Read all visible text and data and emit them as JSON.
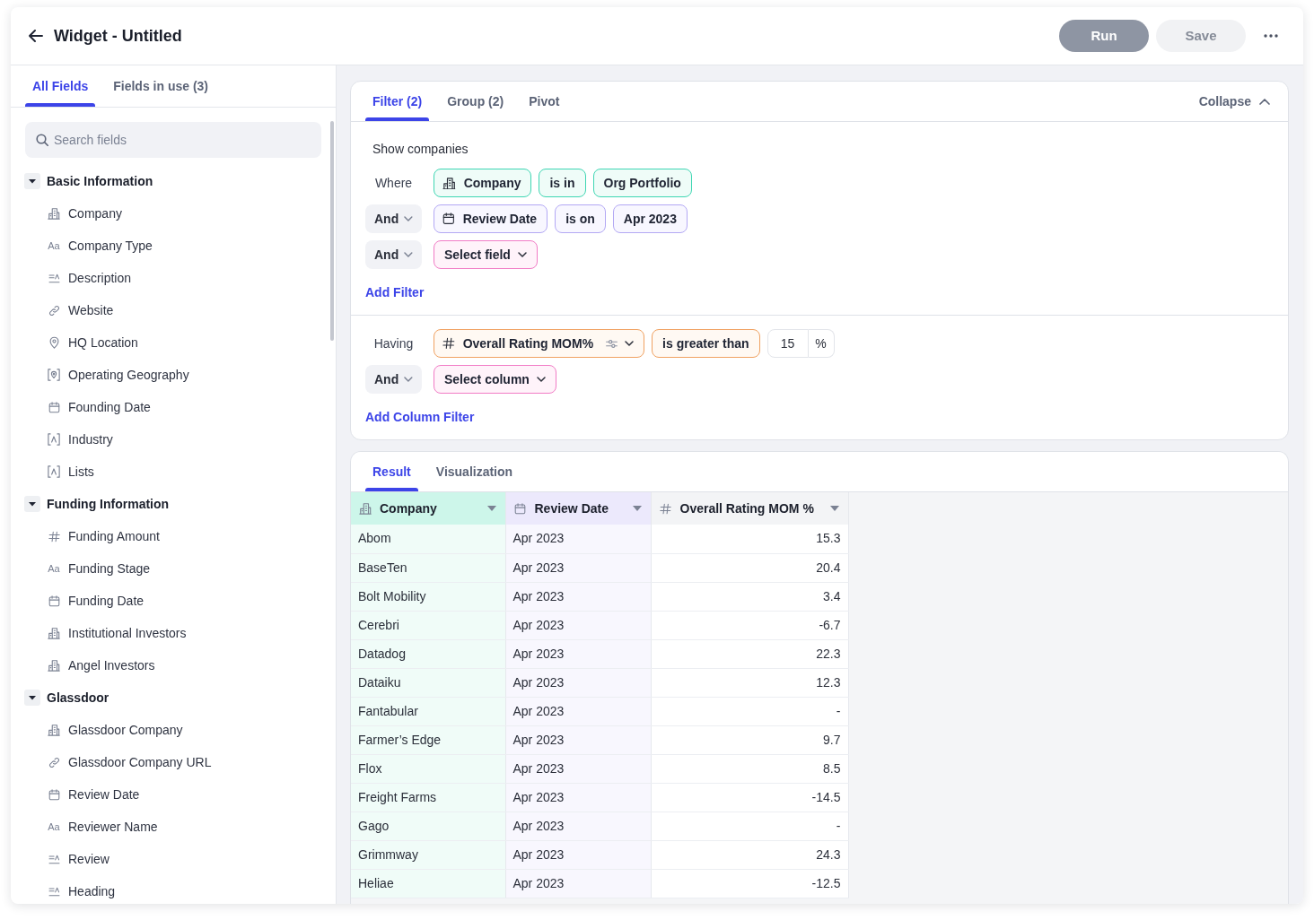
{
  "header": {
    "title": "Widget - Untitled",
    "buttons": [
      {
        "label": "Run",
        "kind": "primary",
        "disabled": true
      },
      {
        "label": "Save",
        "kind": "secondary",
        "disabled": true
      }
    ]
  },
  "sidebar": {
    "tabs": [
      {
        "label": "All Fields",
        "selected": true
      },
      {
        "label": "Fields in use (3)",
        "selected": false
      }
    ],
    "search": {
      "placeholder": "Search fields"
    },
    "groups": [
      {
        "label": "Basic Information",
        "expanded": true,
        "children": [
          {
            "label": "Company",
            "kind": "entity"
          },
          {
            "label": "Company Type",
            "kind": "text",
            "glyph": "Aa"
          },
          {
            "label": "Description",
            "kind": "longtext"
          },
          {
            "label": "Website",
            "kind": "link"
          },
          {
            "label": "HQ Location",
            "kind": "location"
          },
          {
            "label": "Operating Geography",
            "kind": "region"
          },
          {
            "label": "Founding Date",
            "kind": "date"
          },
          {
            "label": "Industry",
            "kind": "tag"
          },
          {
            "label": "Lists",
            "kind": "tag"
          }
        ]
      },
      {
        "label": "Funding Information",
        "expanded": true,
        "children": [
          {
            "label": "Funding Amount",
            "kind": "number"
          },
          {
            "label": "Funding Stage",
            "kind": "text",
            "glyph": "Aa"
          },
          {
            "label": "Funding Date",
            "kind": "date"
          },
          {
            "label": "Institutional Investors",
            "kind": "entity"
          },
          {
            "label": "Angel Investors",
            "kind": "entity"
          }
        ]
      },
      {
        "label": "Glassdoor",
        "expanded": true,
        "children": [
          {
            "label": "Glassdoor Company",
            "kind": "entity"
          },
          {
            "label": "Glassdoor Company URL",
            "kind": "link"
          },
          {
            "label": "Review Date",
            "kind": "date"
          },
          {
            "label": "Reviewer Name",
            "kind": "text",
            "glyph": "Aa"
          },
          {
            "label": "Review",
            "kind": "longtext"
          },
          {
            "label": "Heading",
            "kind": "longtext"
          }
        ]
      }
    ]
  },
  "query": {
    "tabs": [
      {
        "label": "Filter (2)",
        "selected": true
      },
      {
        "label": "Group (2)",
        "selected": false
      },
      {
        "label": "Pivot",
        "selected": false
      }
    ],
    "collapse": "Collapse",
    "sections": [
      {
        "intro": "Show companies",
        "rows": [
          {
            "kind": "condition",
            "connector": {
              "label": "Where",
              "dropdown": false
            },
            "field": {
              "label": "Company",
              "kind": "entity",
              "dropdown": false
            },
            "operator": "is in",
            "value": {
              "kind": "chip",
              "text": "Org Portfolio"
            }
          },
          {
            "kind": "condition",
            "connector": {
              "label": "And",
              "dropdown": true
            },
            "field": {
              "label": "Review Date",
              "kind": "date",
              "dropdown": false
            },
            "operator": "is on",
            "value": {
              "kind": "chip",
              "text": "Apr 2023"
            }
          },
          {
            "kind": "picker",
            "connector": {
              "label": "And",
              "dropdown": true
            },
            "label": "Select field"
          }
        ],
        "add": "Add Filter"
      },
      {
        "rows": [
          {
            "kind": "condition",
            "connector": {
              "label": "Having",
              "dropdown": false
            },
            "field": {
              "label": "Overall Rating MOM%",
              "kind": "number",
              "dropdown": true
            },
            "operator": "is greater than",
            "value": {
              "kind": "input",
              "text": "15",
              "unit": "%"
            }
          },
          {
            "kind": "picker",
            "connector": {
              "label": "And",
              "dropdown": true
            },
            "label": "Select column"
          }
        ],
        "add": "Add Column Filter"
      }
    ]
  },
  "results": {
    "tabs": [
      {
        "label": "Result",
        "selected": true
      },
      {
        "label": "Visualization",
        "selected": false
      }
    ],
    "table": {
      "columns": [
        {
          "label": "Company",
          "kind": "entity"
        },
        {
          "label": "Review Date",
          "kind": "date"
        },
        {
          "label": "Overall Rating MOM %",
          "kind": "number"
        }
      ],
      "rows": [
        [
          "Abom",
          "Apr 2023",
          "15.3"
        ],
        [
          "BaseTen",
          "Apr 2023",
          "20.4"
        ],
        [
          "Bolt Mobility",
          "Apr 2023",
          "3.4"
        ],
        [
          "Cerebri",
          "Apr 2023",
          "-6.7"
        ],
        [
          "Datadog",
          "Apr 2023",
          "22.3"
        ],
        [
          "Dataiku",
          "Apr 2023",
          "12.3"
        ],
        [
          "Fantabular",
          "Apr 2023",
          "-"
        ],
        [
          "Farmer’s Edge",
          "Apr 2023",
          "9.7"
        ],
        [
          "Flox",
          "Apr 2023",
          "8.5"
        ],
        [
          "Freight Farms",
          "Apr 2023",
          "-14.5"
        ],
        [
          "Gago",
          "Apr 2023",
          "-"
        ],
        [
          "Grimmway",
          "Apr 2023",
          "24.3"
        ],
        [
          "Heliae",
          "Apr 2023",
          "-12.5"
        ]
      ]
    }
  }
}
